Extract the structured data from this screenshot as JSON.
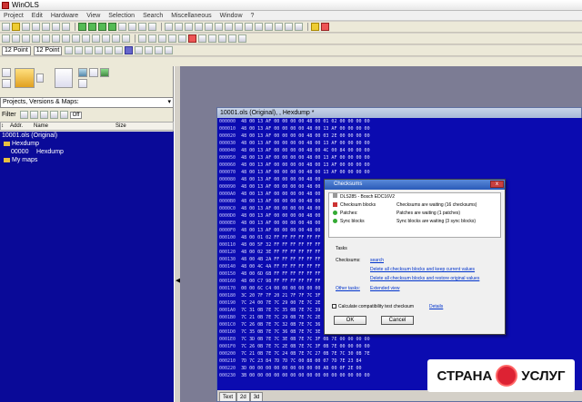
{
  "window": {
    "title": "WinOLS"
  },
  "menu": [
    "Project",
    "Edit",
    "Hardware",
    "View",
    "Selection",
    "Search",
    "Miscellaneous",
    "Window",
    "?"
  ],
  "toolbar": {
    "font_point_1": "12 Point",
    "font_point_2": "12 Point"
  },
  "left_pane": {
    "header": "Projects, Versions & Maps:",
    "filter_label": "Filter",
    "filter_off": "Off",
    "columns": [
      "Addr.",
      "Name",
      "Size"
    ],
    "tree": [
      {
        "label": "10001.ols (Original)",
        "level": 0
      },
      {
        "label": "Hexdump",
        "level": 1
      },
      {
        "addr": "00000",
        "name": "Hexdump",
        "level": 2
      },
      {
        "label": "My maps",
        "level": 1
      }
    ]
  },
  "hex_window": {
    "title": "10001.ols (Original), , Hexdump *",
    "tab": "Text",
    "tab2": "2d",
    "tab3": "3d",
    "rows": [
      {
        "addr": "000000",
        "bytes": "48 00 13 AF 00 00 00 00 48 00 01 02 00 00 00 00"
      },
      {
        "addr": "000010",
        "bytes": "48 00 13 AF 00 00 00 00 48 00 13 AF 00 00 00 00"
      },
      {
        "addr": "000020",
        "bytes": "48 00 13 AF 00 00 00 00 48 00 03 2E 00 00 00 00"
      },
      {
        "addr": "000030",
        "bytes": "48 00 13 AF 00 00 00 00 48 00 13 AF 00 00 00 00"
      },
      {
        "addr": "000040",
        "bytes": "48 00 13 AF 00 00 00 00 48 00 4C 00 84 00 00 00"
      },
      {
        "addr": "000050",
        "bytes": "48 00 13 AF 00 00 00 00 48 00 13 AF 00 00 00 00"
      },
      {
        "addr": "000060",
        "bytes": "48 00 13 AF 00 00 00 00 48 00 13 AF 00 00 00 00"
      },
      {
        "addr": "000070",
        "bytes": "48 00 13 AF 00 00 00 00 48 00 13 AF 00 00 00 00"
      },
      {
        "addr": "000080",
        "bytes": "48 00 13 AF 00 00 00 00 48 00"
      },
      {
        "addr": "000090",
        "bytes": "48 00 13 AF 00 00 00 00 48 00"
      },
      {
        "addr": "0000A0",
        "bytes": "48 00 13 AF 00 00 00 00 48 00"
      },
      {
        "addr": "0000B0",
        "bytes": "48 00 13 AF 00 00 00 00 48 00"
      },
      {
        "addr": "0000C0",
        "bytes": "48 00 13 AF 00 00 00 00 48 00"
      },
      {
        "addr": "0000D0",
        "bytes": "48 00 13 AF 00 00 00 00 48 00"
      },
      {
        "addr": "0000E0",
        "bytes": "48 00 13 AF 00 00 00 00 48 00"
      },
      {
        "addr": "0000F0",
        "bytes": "48 00 13 AF 00 00 00 00 48 00"
      },
      {
        "addr": "000100",
        "bytes": "48 00 01 02 FF FF FF FF FF FF"
      },
      {
        "addr": "000110",
        "bytes": "48 00 5F 32 FF FF FF FF FF FF"
      },
      {
        "addr": "000120",
        "bytes": "48 00 02 3E FF FF FF FF FF FF"
      },
      {
        "addr": "000130",
        "bytes": "48 00 4B 2A FF FF FF FF FF FF"
      },
      {
        "addr": "000140",
        "bytes": "48 00 4C 4A FF FF FF FF FF FF"
      },
      {
        "addr": "000150",
        "bytes": "48 00 6D 6B FF FF FF FF FF FF"
      },
      {
        "addr": "000160",
        "bytes": "48 00 C7 98 FF FF FF FF FF FF"
      },
      {
        "addr": "000170",
        "bytes": "00 00 6C C4 00 00 00 00 00 00"
      },
      {
        "addr": "000180",
        "bytes": "3C 20 7F 7F 20 21 7F 7F 7C 3F"
      },
      {
        "addr": "000190",
        "bytes": "7C 24 00 7E 7C 29 00 7E 7C 2E"
      },
      {
        "addr": "0001A0",
        "bytes": "7C 31 0B 7E 7C 35 0B 7E 7C 39"
      },
      {
        "addr": "0001B0",
        "bytes": "7C 21 0B 7E 7C 29 0B 7E 7C 2E"
      },
      {
        "addr": "0001C0",
        "bytes": "7C 26 0B 7E 7C 32 0B 7E 7C 36"
      },
      {
        "addr": "0001D0",
        "bytes": "7C 35 0B 7E 7C 36 0B 7E 7C 3E"
      },
      {
        "addr": "0001E0",
        "bytes": "7C 3D 0B 7E 7C 3E 0B 7E 7C 3F 0B 7E 00 00 00 00"
      },
      {
        "addr": "0001F0",
        "bytes": "7C 26 0B 7E 7C 2E 0B 7E 7C 3F 0B 7E 00 00 00 00"
      },
      {
        "addr": "000200",
        "bytes": "7C 21 0B 7E 7C 24 0B 7E 7C 27 0B 7E 7C 30 0B 7E"
      },
      {
        "addr": "000210",
        "bytes": "7D 7C 23 84 7D 7D 7C 00 88 00 07 7D 7E 23 84"
      },
      {
        "addr": "000220",
        "bytes": "3D 00 00 00 00 00 00 00 00 00 AB 00 0F 2E 00"
      },
      {
        "addr": "000230",
        "bytes": "3B 00 00 00 00 00 00 00 00 00 00 00 00 00 00 00"
      }
    ]
  },
  "dialog": {
    "title": "Checksums",
    "ecu": "DLS285 - Bosch EDC16V2",
    "items": [
      {
        "label": "Checksum blocks",
        "status": "Checksums are waiting (16 checksums)"
      },
      {
        "label": "Patches:",
        "status": "Patches are waiting (1 patches)"
      },
      {
        "label": "Sync blocks",
        "status": "Sync blocks are waiting (3 sync blocks)"
      }
    ],
    "tasks_label": "Tasks",
    "checksums_label": "Checksums:",
    "search_link": "search",
    "link_delete_keep": "Delete all checksum blocks and keep current values",
    "link_delete_restore": "Delete all checksum blocks and restore original values",
    "other_tasks_label": "Other tasks:",
    "extended_view_link": "Extended view",
    "calc_checkbox": "Calculate compatibility test checksum",
    "details_link": "Details",
    "ok_button": "OK",
    "cancel_button": "Cancel"
  },
  "watermark": {
    "left": "СТРАНА",
    "right": "УСЛУГ"
  }
}
